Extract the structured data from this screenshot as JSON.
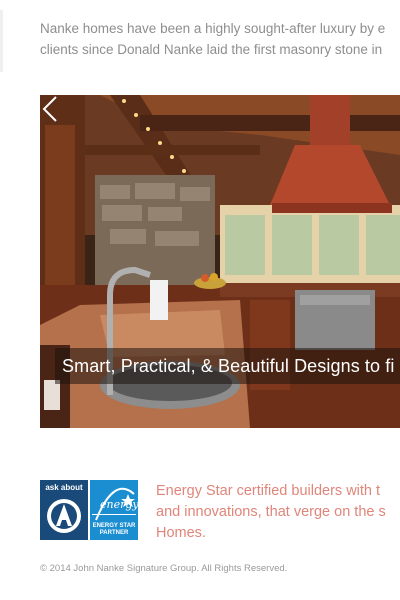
{
  "intro": {
    "line1": "Nanke homes have been a highly sought-after luxury by e",
    "line2": "clients since Donald Nanke laid the first masonry stone in"
  },
  "slider": {
    "caption": "Smart, Practical, & Beautiful Designs to fi",
    "prev_icon": "chevron-left-icon"
  },
  "badges": {
    "ask_about": "ask about",
    "energy_star_partner": "ENERGY STAR PARTNER"
  },
  "energy": {
    "line1": "Energy Star certified builders with t",
    "line2": "and innovations, that verge on the s",
    "line3": "Homes."
  },
  "footer": {
    "copyright": "© 2014 John Nanke Signature Group. All Rights Reserved."
  }
}
